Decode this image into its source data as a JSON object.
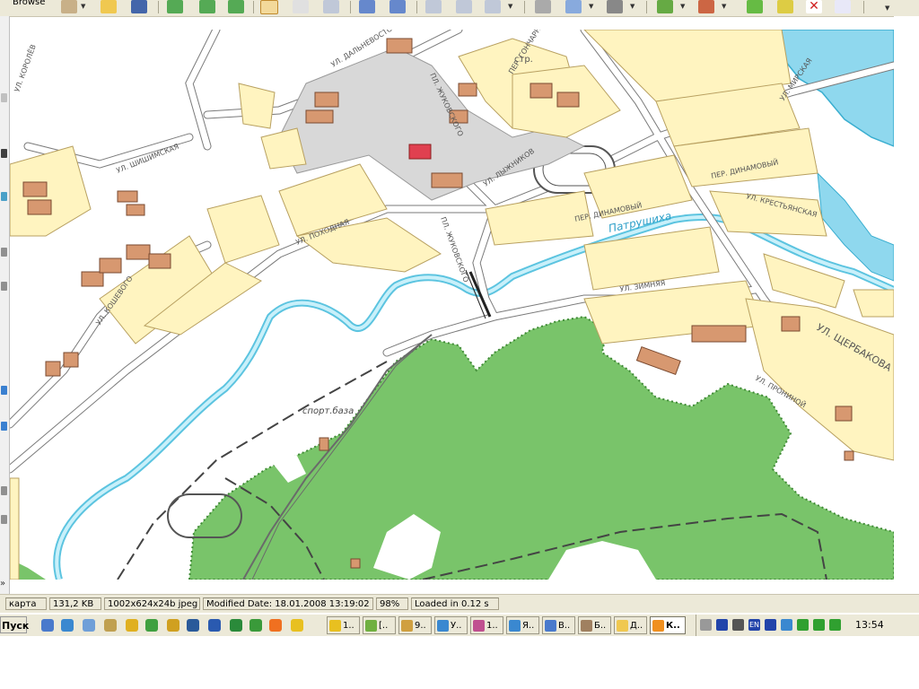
{
  "app": {
    "toolbar_label": "Browse"
  },
  "map": {
    "labels": {
      "street_korolev": "УЛ. КОРОЛЁВ",
      "street_shishimskaya": "УЛ. ШИШИМСКАЯ",
      "street_dalnevostochnaya": "УЛ. ДАЛЬНЕВОСТОЧНАЯ",
      "street_zhukovskogo_1": "ПЛ. ЖУКОВСКОГО",
      "street_goncharny": "ПЕР. ГОНЧАРНЫЙ",
      "building_str": "стр.",
      "street_mirskaya": "УЛ. МИРСКАЯ",
      "street_lyzhnikov": "УЛ. ЛЫЖНИКОВ",
      "street_dinamovy_1": "ПЕР. ДИНАМОВЫЙ",
      "street_krestyanskaya": "УЛ. КРЕСТЬЯНСКАЯ",
      "street_pokhodnaya": "УЛ. ПОХОДНАЯ",
      "street_zhukovskogo_2": "ПЛ. ЖУКОВСКОГО",
      "street_dinamovy_2": "ПЕР. ДИНАМОВЫЙ",
      "river": "Патрушиха",
      "street_zimnyaya": "УЛ. ЗИМНЯЯ",
      "street_koshevogo": "УЛ. КОШЕВОГО",
      "street_shcherbakova": "УЛ. ЩЕРБАКОВА",
      "street_proninoy": "УЛ. ПРОНИНОЙ",
      "sport_base": "спорт.база"
    }
  },
  "status": {
    "name": "карта",
    "size": "131,2 KB",
    "dimensions": "1002x624x24b jpeg",
    "modified": "Modified Date: 18.01.2008 13:19:02",
    "zoom": "98%",
    "loaded": "Loaded in 0.12 s"
  },
  "taskbar": {
    "start": "Пуск",
    "tasks": [
      "1..",
      "[..",
      "9..",
      "У..",
      "1..",
      "Я..",
      "В..",
      "Б..",
      "Д..",
      "К.."
    ],
    "clock": "13:54",
    "lang": "EN"
  }
}
